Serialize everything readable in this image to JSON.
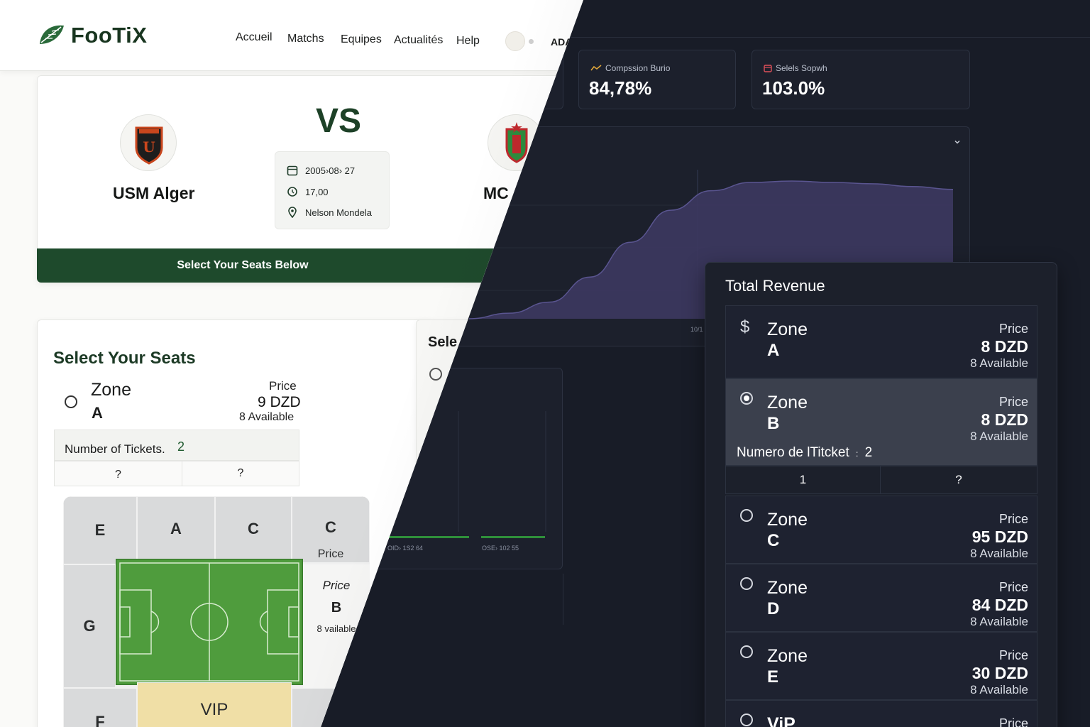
{
  "header": {
    "brand": "FooTiX",
    "nav": [
      "Accueil",
      "Matchs",
      "Equipes",
      "Actualités",
      "Help"
    ],
    "user_label": "ADA"
  },
  "match": {
    "home_team": "USM Alger",
    "away_team": "MC A",
    "vs": "VS",
    "date": "2005›08› 27",
    "time": "17,00",
    "venue": "Nelson Mondela",
    "cta": "Select Your Seats Below"
  },
  "seat_select": {
    "title": "Select Your Seats",
    "zone_word": "Zone",
    "zone_letter": "A",
    "price_label": "Price",
    "price": "9 DZD",
    "available": "8 Available",
    "tickets_label": "Number of Tickets.",
    "tickets_value": "2",
    "stepper_left": "?",
    "stepper_right": "?",
    "partial_title": "Sele"
  },
  "stadium": {
    "top_cells": [
      "E",
      "A",
      "C",
      "C"
    ],
    "top_right_price": "Price",
    "left_cell": "G",
    "right_price": "Price",
    "right_zone": "B",
    "right_avail": "8 vailable",
    "bottom_left": "F",
    "bottom_vip": "VIP"
  },
  "kpis": [
    {
      "label": "Compssion Burio",
      "value": "84,78%",
      "icon": "trend-icon"
    },
    {
      "label": "Selels Sopwh",
      "value": "103.0%",
      "icon": "calendar-icon"
    }
  ],
  "chart_data": {
    "type": "area",
    "x_tick_label": "10/1",
    "series": [
      {
        "values": [
          0,
          4,
          12,
          30,
          55,
          78,
          92,
          98,
          99,
          98,
          97,
          95,
          93
        ]
      }
    ],
    "ylim": [
      0,
      100
    ],
    "grid": true
  },
  "mini_chart": {
    "labels": [
      "OID› 1S2 64",
      "OSE› 102 55"
    ]
  },
  "revenue": {
    "title": "Total Revenue",
    "price_label": "Price",
    "zone_word": "Zone",
    "zones": [
      {
        "letter": "A",
        "price": "8 DZD",
        "available": "8 Available",
        "icon": "dollar-icon",
        "selected": false
      },
      {
        "letter": "B",
        "price": "8 DZD",
        "available": "8 Available",
        "icon": "radio-on",
        "selected": true
      },
      {
        "letter": "C",
        "price": "95 DZD",
        "available": "8 Available",
        "icon": "radio-off",
        "selected": false
      },
      {
        "letter": "D",
        "price": "84 DZD",
        "available": "8 Available",
        "icon": "radio-off",
        "selected": false
      },
      {
        "letter": "E",
        "price": "30 DZD",
        "available": "8 Available",
        "icon": "radio-off",
        "selected": false
      }
    ],
    "ticket_label": "Numero de lTitcket",
    "ticket_sep": ":",
    "ticket_value": "2",
    "stepper_left": "1",
    "stepper_right": "?",
    "last_row_label": "ViP",
    "last_row_price_label": "Price"
  },
  "colors": {
    "brand_green": "#1e4a2c",
    "pitch_green": "#4a9a3a",
    "dark_bg": "#181c27",
    "area_fill": "#3d3960"
  }
}
